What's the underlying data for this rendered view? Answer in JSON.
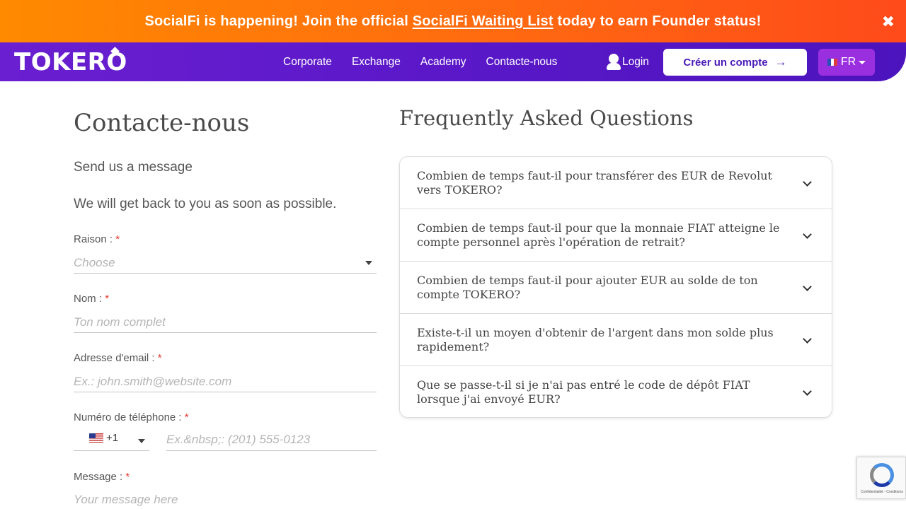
{
  "banner": {
    "lead": "SocialFi is happening!",
    "part1": " Join the official ",
    "link": "SocialFi Waiting List",
    "part2": " today to earn Founder status!",
    "close": "✖"
  },
  "nav": {
    "logo": "TOKERO",
    "links": [
      "Corporate",
      "Exchange",
      "Academy",
      "Contacte-nous"
    ],
    "login": "Login",
    "cta": "Créer un compte",
    "cta_arrow": "→",
    "lang": "FR"
  },
  "form": {
    "title": "Contacte-nous",
    "subtitle": "Send us a message",
    "subtitle2": "We will get back to you as soon as possible.",
    "reason": {
      "label": "Raison :",
      "placeholder": "Choose"
    },
    "name": {
      "label": "Nom :",
      "placeholder": "Ton nom complet"
    },
    "email": {
      "label": "Adresse d'email :",
      "placeholder": "Ex.: john.smith@website.com"
    },
    "phone": {
      "label": "Numéro de téléphone :",
      "code": "+1",
      "placeholder": "Ex.&nbsp;: (201) 555-0123"
    },
    "message": {
      "label": "Message :",
      "placeholder": "Your message here"
    },
    "required_mark": "*"
  },
  "faq": {
    "title": "Frequently Asked Questions",
    "items": [
      {
        "q": "Combien de temps faut-il pour transférer des EUR de Revolut vers TOKERO?"
      },
      {
        "q": "Combien de temps faut-il pour que la monnaie FIAT atteigne le compte personnel après l'opération de retrait?"
      },
      {
        "q": "Combien de temps faut-il pour ajouter EUR au solde de ton compte TOKERO?"
      },
      {
        "q": "Existe-t-il un moyen d'obtenir de l'argent dans mon solde plus rapidement?"
      },
      {
        "q": "Que se passe-t-il si je n'ai pas entré le code de dépôt FIAT lorsque j'ai envoyé EUR?"
      }
    ]
  },
  "recaptcha": {
    "text": "Confidentialité - Conditions"
  },
  "colors": {
    "accent": "#5a18c8",
    "banner": "#ff6a10",
    "lang_button": "#9a2fe0",
    "required": "#e53935"
  }
}
